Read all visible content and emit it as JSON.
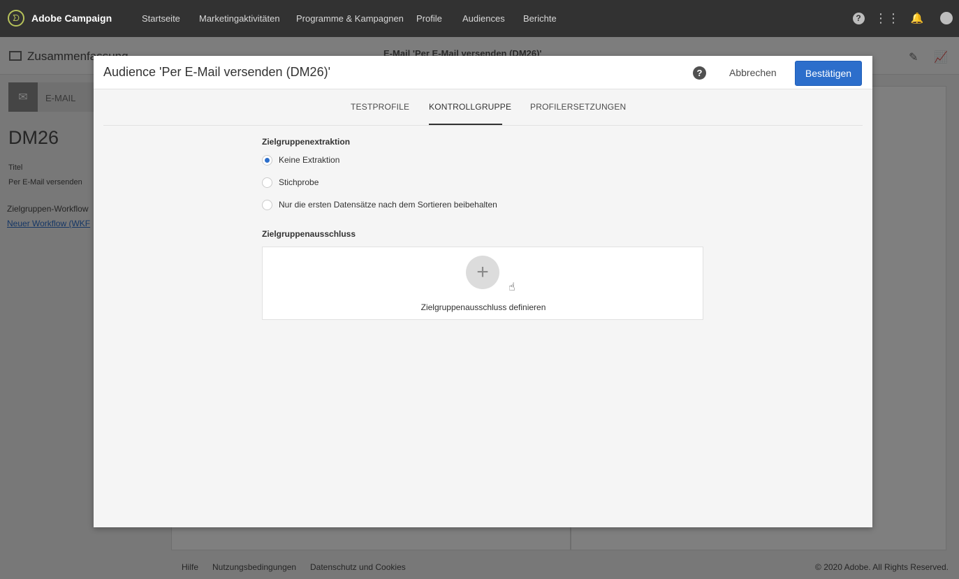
{
  "topnav": {
    "app_title": "Adobe Campaign",
    "items": [
      {
        "label": "Startseite"
      },
      {
        "label": "Marketingaktivitäten"
      },
      {
        "label": "Programme & Kampagnen"
      },
      {
        "label": "Profile"
      },
      {
        "label": "Audiences"
      },
      {
        "label": "Berichte"
      }
    ],
    "icons": [
      "help-icon",
      "apps-grid-icon",
      "bell-icon",
      "avatar"
    ]
  },
  "background": {
    "summary_title": "Zusammenfassung",
    "email_title": "E-Mail 'Per E-Mail versenden (DM26)'",
    "email_label": "E-MAIL",
    "code": "DM26",
    "title_label": "Titel",
    "title_value": "Per E-Mail versenden",
    "workflow_label": "Zielgruppen-Workflow",
    "workflow_link": "Neuer Workflow (WKF",
    "footer": {
      "links": [
        "Hilfe",
        "Nutzungsbedingungen",
        "Datenschutz und Cookies"
      ],
      "copyright": "© 2020 Adobe. All Rights Reserved."
    }
  },
  "modal": {
    "title": "Audience 'Per E-Mail versenden (DM26)'",
    "cancel_label": "Abbrechen",
    "confirm_label": "Bestätigen",
    "tabs": [
      {
        "label": "TESTPROFILE",
        "active": false
      },
      {
        "label": "KONTROLLGRUPPE",
        "active": true
      },
      {
        "label": "PROFILERSETZUNGEN",
        "active": false
      }
    ],
    "extraction": {
      "title": "Zielgruppenextraktion",
      "options": [
        {
          "label": "Keine Extraktion",
          "checked": true
        },
        {
          "label": "Stichprobe",
          "checked": false
        },
        {
          "label": "Nur die ersten Datensätze nach dem Sortieren beibehalten",
          "checked": false
        }
      ]
    },
    "exclusion": {
      "title": "Zielgruppenausschluss",
      "define_label": "Zielgruppenausschluss definieren"
    }
  },
  "colors": {
    "accent": "#2c6ecb",
    "nav_bg": "#323232"
  }
}
